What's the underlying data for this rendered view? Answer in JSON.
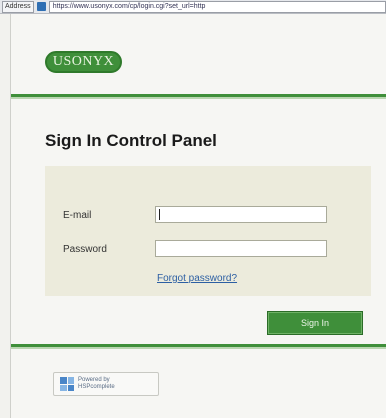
{
  "browser": {
    "address_label": "Address",
    "url": "https://www.usonyx.com/cp/login.cgi?set_url=http"
  },
  "brand": {
    "logo_text": "USONYX"
  },
  "page": {
    "title": "Sign In Control Panel"
  },
  "form": {
    "email_label": "E-mail",
    "email_value": "",
    "password_label": "Password",
    "password_value": "",
    "forgot_link": "Forgot password?",
    "signin_label": "Sign In"
  },
  "footer": {
    "powered_line1": "Powered by",
    "powered_line2": "HSPcomplete"
  },
  "colors": {
    "brand_green": "#3f8f3a",
    "panel_bg": "#ecebdc",
    "link_blue": "#2c5fa3"
  }
}
